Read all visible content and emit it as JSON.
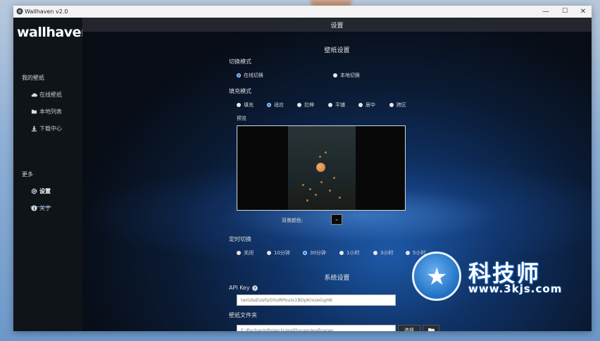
{
  "window": {
    "title": "Wallhaven v2.0",
    "controls": {
      "minimize": "—",
      "maximize": "☐",
      "close": "✕"
    }
  },
  "sidebar": {
    "logo": "wallhaven",
    "section_wallpapers": "我的壁纸",
    "items": [
      {
        "label": "在线壁纸",
        "icon": "cloud-icon"
      },
      {
        "label": "本地列表",
        "icon": "folder-icon"
      },
      {
        "label": "下载中心",
        "icon": "download-icon"
      }
    ],
    "section_more": "更多",
    "more_items": [
      {
        "label": "设置",
        "icon": "gear-icon",
        "active": true
      },
      {
        "label": "关于",
        "icon": "info-icon"
      }
    ]
  },
  "page": {
    "title": "设置",
    "wallpaper_section": "壁纸设置",
    "switch_mode": {
      "label": "切换模式",
      "options": [
        {
          "label": "在线切换",
          "selected": true
        },
        {
          "label": "本地切换",
          "selected": false
        }
      ]
    },
    "fill_mode": {
      "label": "填充模式",
      "options": [
        {
          "label": "填充",
          "selected": false
        },
        {
          "label": "适应",
          "selected": true
        },
        {
          "label": "拉伸",
          "selected": false
        },
        {
          "label": "平铺",
          "selected": false
        },
        {
          "label": "居中",
          "selected": false
        },
        {
          "label": "跨区",
          "selected": false
        }
      ]
    },
    "preview_label": "预览",
    "bg_color_label": "背景颜色:",
    "bg_color": "#0a0a0a",
    "timer": {
      "label": "定时切换",
      "options": [
        {
          "label": "关闭",
          "selected": false
        },
        {
          "label": "10分钟",
          "selected": false
        },
        {
          "label": "30分钟",
          "selected": true
        },
        {
          "label": "1小时",
          "selected": false
        },
        {
          "label": "3小时",
          "selected": false
        },
        {
          "label": "5小时",
          "selected": false
        }
      ]
    },
    "system_section": "系统设置",
    "api_key": {
      "label": "API Key",
      "value": "twGdaEUsFyGYuIRPoulx1BDpKmzeGgHK"
    },
    "folder": {
      "label": "壁纸文件夹",
      "value": "E:/PycharmProjects/wallhaven/wallpaper",
      "choose_label": "选择"
    }
  },
  "watermark": {
    "brand": "科技师",
    "url": "www.3kjs.com"
  },
  "colors": {
    "accent": "#2d8cf0",
    "sidebar_bg": "#0f1419"
  }
}
